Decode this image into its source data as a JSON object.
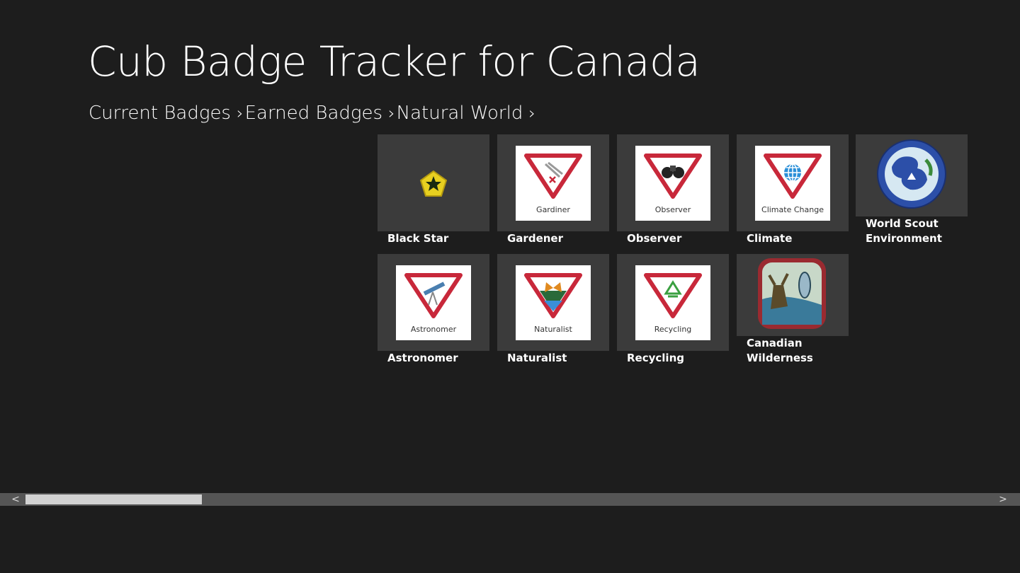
{
  "app": {
    "title": "Cub Badge Tracker for Canada"
  },
  "breadcrumb": [
    "Current Badges",
    "Earned Badges",
    "Natural World"
  ],
  "badges": [
    {
      "label": "Black Star",
      "image_caption": ""
    },
    {
      "label": "Gardener",
      "image_caption": "Gardiner"
    },
    {
      "label": "Observer",
      "image_caption": "Observer"
    },
    {
      "label": "Climate Change",
      "image_caption": "Climate Change"
    },
    {
      "label": "World Scout Environment",
      "image_caption": ""
    },
    {
      "label": "Astronomer",
      "image_caption": "Astronomer"
    },
    {
      "label": "Naturalist",
      "image_caption": "Naturalist"
    },
    {
      "label": "Recycling",
      "image_caption": "Recycling"
    },
    {
      "label": "Canadian Wilderness",
      "image_caption": ""
    }
  ],
  "scrollbar": {
    "left_arrow": "<",
    "right_arrow": ">"
  }
}
